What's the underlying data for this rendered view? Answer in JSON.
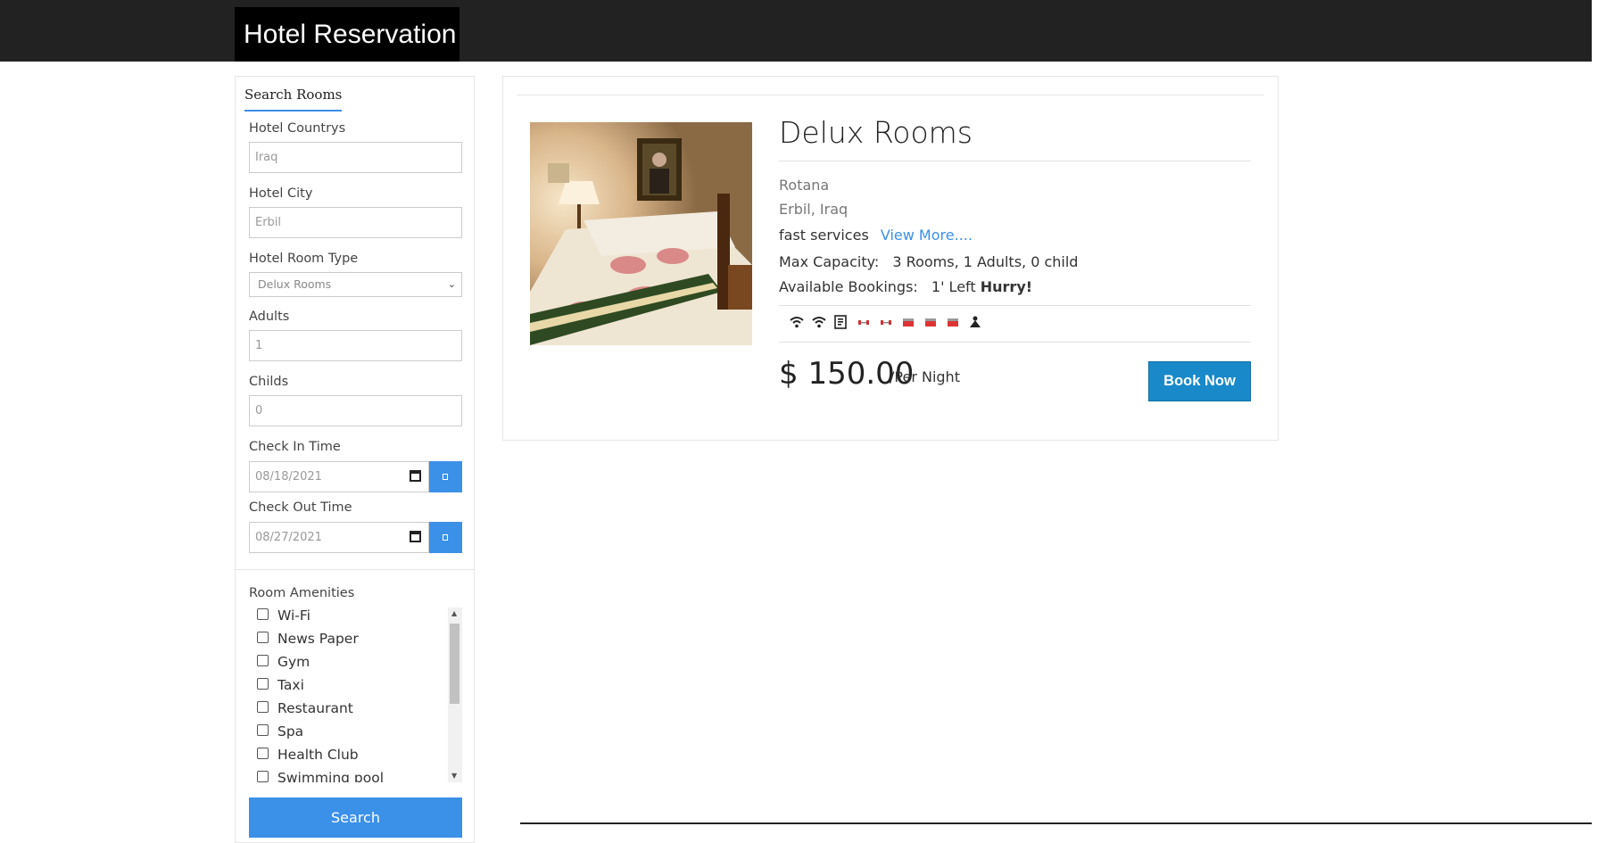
{
  "header": {
    "brand": "Hotel Reservation"
  },
  "sidebar": {
    "title": "Search Rooms",
    "country": {
      "label": "Hotel Countrys",
      "value": "Iraq"
    },
    "city": {
      "label": "Hotel City",
      "value": "Erbil"
    },
    "room_type": {
      "label": "Hotel Room Type",
      "value": "Delux Rooms"
    },
    "adults": {
      "label": "Adults",
      "value": "1"
    },
    "childs": {
      "label": "Childs",
      "value": "0"
    },
    "check_in": {
      "label": "Check In Time",
      "value": "08/18/2021"
    },
    "check_out": {
      "label": "Check Out Time",
      "value": "08/27/2021"
    },
    "amenities_label": "Room Amenities",
    "amenities": [
      "Wi-Fi",
      "News Paper",
      "Gym",
      "Taxi",
      "Restaurant",
      "Spa",
      "Health Club",
      "Swimming pool"
    ],
    "search_label": "Search"
  },
  "room": {
    "title": "Delux Rooms",
    "hotel": "Rotana",
    "location": "Erbil, Iraq",
    "description": "fast services",
    "view_more": "View More....",
    "capacity_label": "Max Capacity:",
    "capacity_value": "3 Rooms, 1 Adults, 0 child",
    "bookings_label": "Available Bookings:",
    "bookings_value": "1' Left",
    "hurry": "Hurry!",
    "price": "$ 150.00",
    "per_night": "/Per Night",
    "book_label": "Book Now",
    "amenity_icons": [
      "wifi-icon",
      "wifi-icon",
      "newspaper-icon",
      "gym-icon",
      "gym-icon",
      "bathtub-icon",
      "bathtub-icon",
      "bathtub-icon",
      "spa-icon"
    ]
  },
  "colors": {
    "accent": "#3b90e8",
    "topbar": "#222222",
    "book": "#1989c9"
  }
}
